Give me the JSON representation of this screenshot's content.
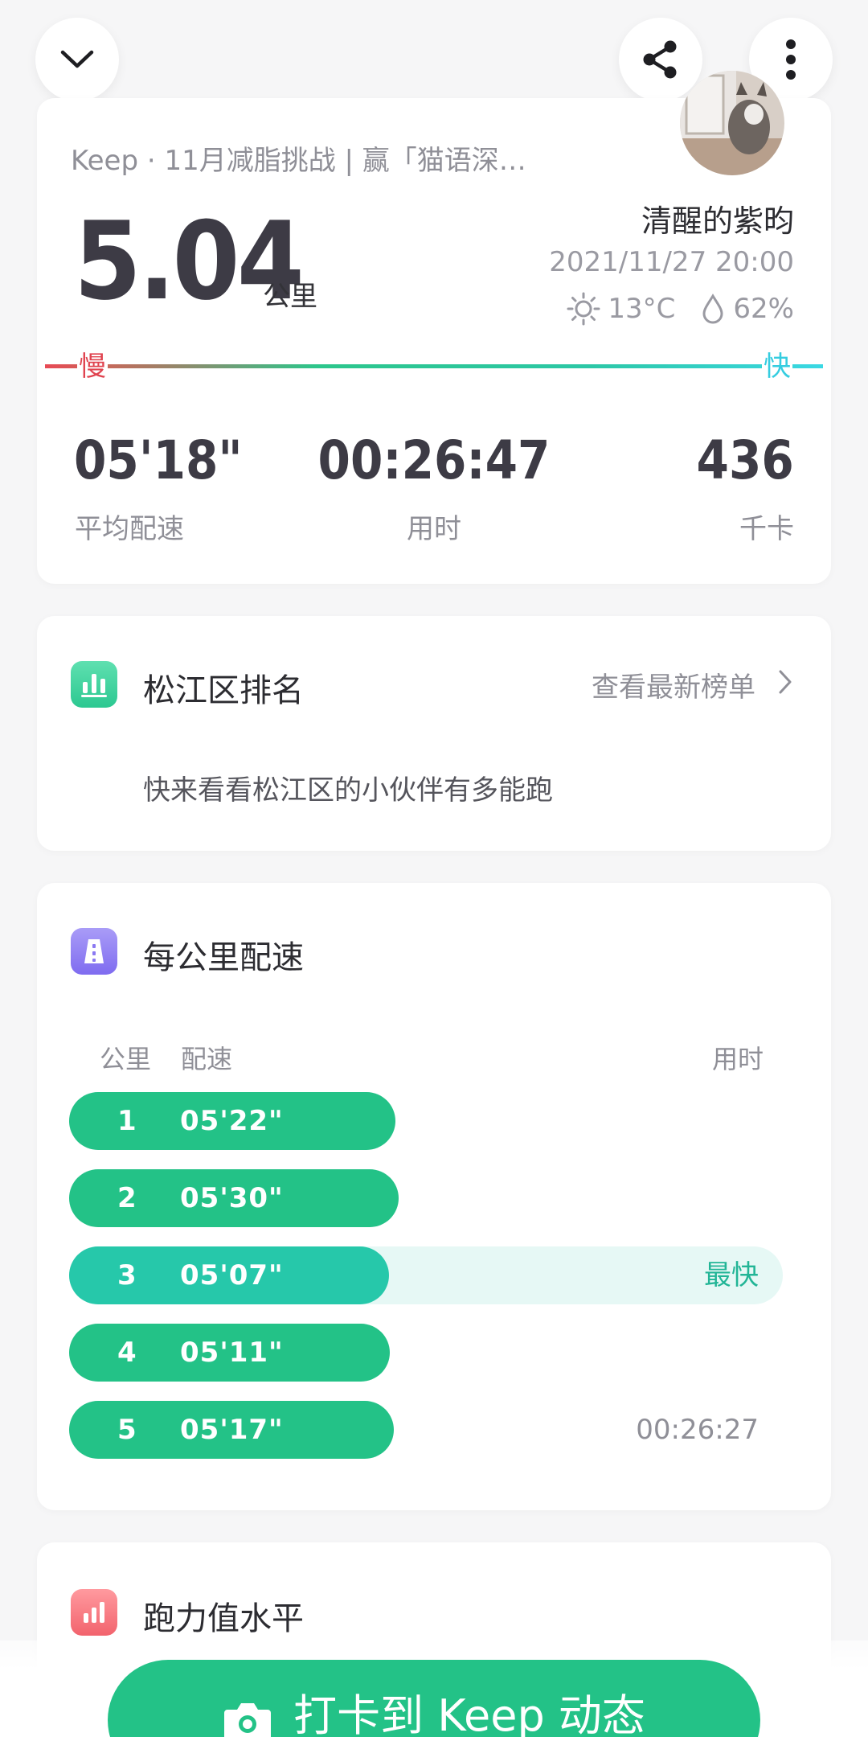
{
  "colors": {
    "accent": "#23c287",
    "slow": "#e0434f",
    "fast": "#35cde0"
  },
  "header": {
    "collapse_icon": "chevron-down-icon",
    "share_icon": "share-icon",
    "more_icon": "more-vertical-icon"
  },
  "summary": {
    "challenge": "Keep · 11月减脂挑战 | 赢「猫语深…",
    "distance": "5.04",
    "distance_unit": "公里",
    "username": "清醒的紫昀",
    "datetime": "2021/11/27 20:00",
    "temperature": "13°C",
    "humidity": "62%",
    "slow_label": "慢",
    "fast_label": "快",
    "stats": [
      {
        "value": "05'18\"",
        "label": "平均配速"
      },
      {
        "value": "00:26:47",
        "label": "用时"
      },
      {
        "value": "436",
        "label": "千卡"
      }
    ]
  },
  "ranking": {
    "title": "松江区排名",
    "link": "查看最新榜单",
    "description": "快来看看松江区的小伙伴有多能跑"
  },
  "splits": {
    "title": "每公里配速",
    "col_km": "公里",
    "col_pace": "配速",
    "col_time": "用时",
    "fastest_label": "最快",
    "rows": [
      {
        "km": "1",
        "pace": "05'22\"",
        "fill": 0.451,
        "time": ""
      },
      {
        "km": "2",
        "pace": "05'30\"",
        "fill": 0.456,
        "time": ""
      },
      {
        "km": "3",
        "pace": "05'07\"",
        "fill": 0.442,
        "time": "",
        "fastest": true
      },
      {
        "km": "4",
        "pace": "05'11\"",
        "fill": 0.443,
        "time": ""
      },
      {
        "km": "5",
        "pace": "05'17\"",
        "fill": 0.449,
        "time": "00:26:27"
      }
    ]
  },
  "running_power": {
    "title": "跑力值水平"
  },
  "checkin": {
    "label": "打卡到 Keep 动态"
  }
}
